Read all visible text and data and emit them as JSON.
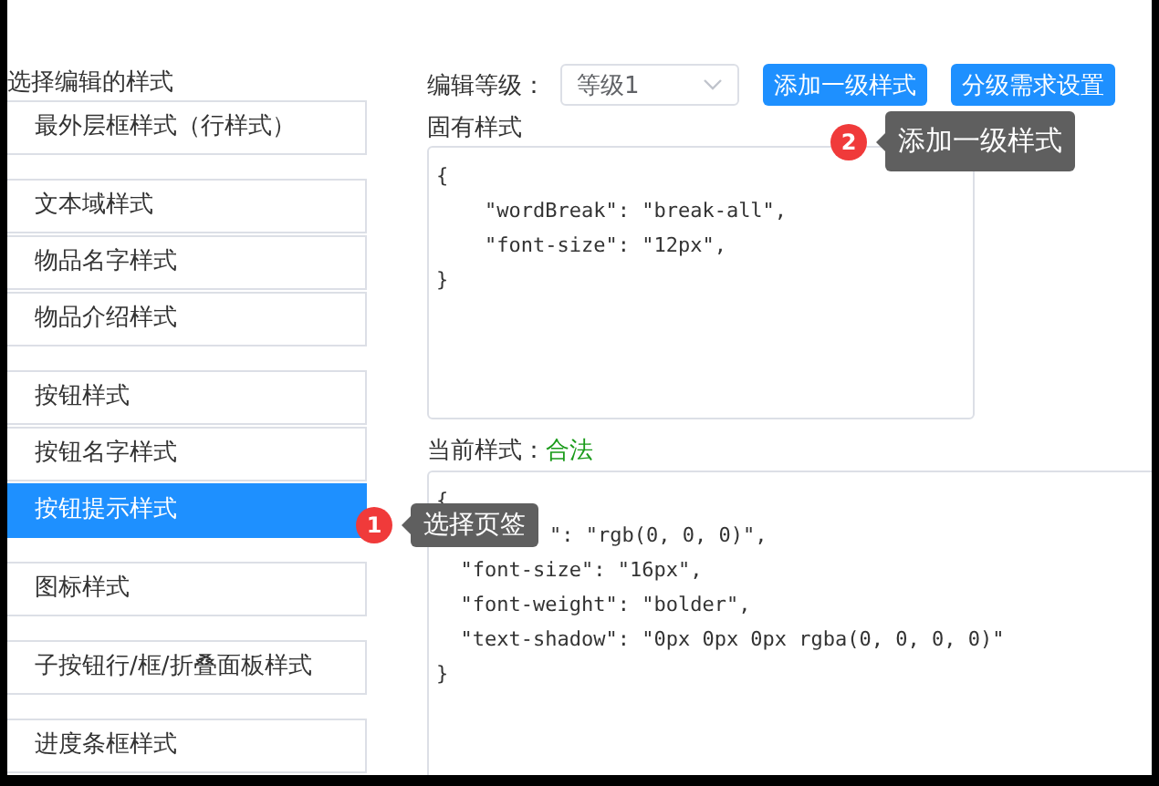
{
  "sidebar": {
    "heading": "选择编辑的样式",
    "groups": [
      {
        "items": [
          {
            "label": "最外层框样式（行样式）",
            "selected": false
          }
        ]
      },
      {
        "items": [
          {
            "label": "文本域样式",
            "selected": false
          },
          {
            "label": "物品名字样式",
            "selected": false
          },
          {
            "label": "物品介绍样式",
            "selected": false
          }
        ]
      },
      {
        "items": [
          {
            "label": "按钮样式",
            "selected": false
          },
          {
            "label": "按钮名字样式",
            "selected": false
          },
          {
            "label": "按钮提示样式",
            "selected": true
          }
        ]
      },
      {
        "items": [
          {
            "label": "图标样式",
            "selected": false
          }
        ]
      },
      {
        "items": [
          {
            "label": "子按钮行/框/折叠面板样式",
            "selected": false
          }
        ]
      },
      {
        "items": [
          {
            "label": "进度条框样式",
            "selected": false
          }
        ]
      }
    ]
  },
  "toolbar": {
    "level_label": "编辑等级：",
    "level_select": {
      "value": "等级1"
    },
    "buttons": [
      "添加一级样式",
      "分级需求设置"
    ]
  },
  "inherent_style": {
    "label": "固有样式",
    "lines": [
      "{",
      "    \"wordBreak\": \"break-all\",",
      "    \"font-size\": \"12px\",",
      "}"
    ]
  },
  "current_style": {
    "label": "当前样式：",
    "status": "合法",
    "lines": [
      "{",
      {
        "kind": "covered",
        "text": "\": \"rgb(0, 0, 0)\","
      },
      "  \"font-size\": \"16px\",",
      "  \"font-weight\": \"bolder\",",
      "  \"text-shadow\": \"0px 0px 0px rgba(0, 0, 0, 0)\"",
      "}"
    ]
  },
  "guide_tips": [
    {
      "number": "1",
      "text": "选择页签"
    },
    {
      "number": "2",
      "text": "添加一级样式"
    }
  ]
}
